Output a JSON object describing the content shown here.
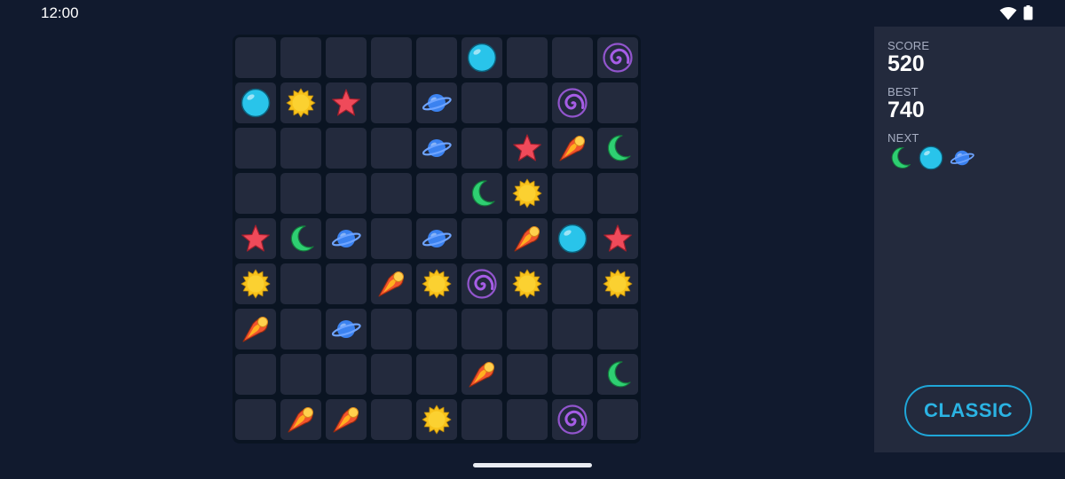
{
  "status_bar": {
    "time": "12:00",
    "icons": [
      "wifi-icon",
      "battery-icon"
    ]
  },
  "board": {
    "rows": 9,
    "cols": 9,
    "cells": [
      [
        "empty",
        "empty",
        "empty",
        "empty",
        "empty",
        "orb",
        "empty",
        "empty",
        "galaxy"
      ],
      [
        "orb",
        "sun",
        "star",
        "empty",
        "planet",
        "empty",
        "empty",
        "galaxy",
        "empty"
      ],
      [
        "empty",
        "empty",
        "empty",
        "empty",
        "planet",
        "empty",
        "star",
        "comet",
        "moon"
      ],
      [
        "empty",
        "empty",
        "empty",
        "empty",
        "empty",
        "moon",
        "sun",
        "empty",
        "empty"
      ],
      [
        "star",
        "moon",
        "planet",
        "empty",
        "planet",
        "empty",
        "comet",
        "orb",
        "star"
      ],
      [
        "sun",
        "empty",
        "empty",
        "comet",
        "sun",
        "galaxy",
        "sun",
        "empty",
        "sun"
      ],
      [
        "comet",
        "empty",
        "planet",
        "empty",
        "empty",
        "empty",
        "empty",
        "empty",
        "empty"
      ],
      [
        "empty",
        "empty",
        "empty",
        "empty",
        "empty",
        "comet",
        "empty",
        "empty",
        "moon"
      ],
      [
        "empty",
        "comet",
        "comet",
        "empty",
        "sun",
        "empty",
        "empty",
        "galaxy",
        "empty"
      ]
    ]
  },
  "panel": {
    "score_label": "SCORE",
    "score": "520",
    "best_label": "BEST",
    "best": "740",
    "next_label": "NEXT",
    "next_pieces": [
      "moon",
      "orb",
      "planet"
    ],
    "mode_button_label": "CLASSIC"
  },
  "colors": {
    "background": "#111a2e",
    "board": "#0a1422",
    "cell": "#232a3d",
    "panel": "#232a3d",
    "accent": "#2bb3e3",
    "orb": "#29c4ea",
    "sun": "#f7c21b",
    "star": "#ef4a5a",
    "moon": "#2ecf72",
    "planet": "#3b82f0",
    "galaxy": "#a65de6",
    "comet": "#f2542d"
  }
}
